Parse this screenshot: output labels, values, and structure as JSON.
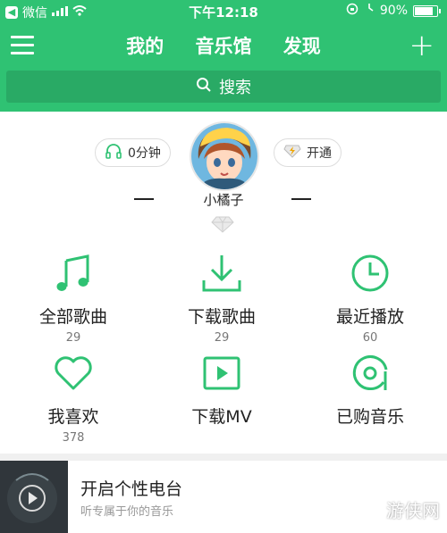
{
  "status_bar": {
    "carrier": "微信",
    "time": "下午12:18",
    "battery": "90%",
    "battery_level": 0.9
  },
  "nav": {
    "tabs": [
      "我的",
      "音乐馆",
      "发现"
    ],
    "menu_icon": "hamburger-menu-icon",
    "add_icon": "plus-icon"
  },
  "search": {
    "label": "搜索"
  },
  "profile": {
    "listen_time": "0分钟",
    "open_vip": "开通",
    "username": "小橘子"
  },
  "grid": [
    {
      "label": "全部歌曲",
      "count": "29",
      "icon": "music-note-icon"
    },
    {
      "label": "下载歌曲",
      "count": "29",
      "icon": "download-icon"
    },
    {
      "label": "最近播放",
      "count": "60",
      "icon": "clock-icon"
    },
    {
      "label": "我喜欢",
      "count": "378",
      "icon": "heart-icon"
    },
    {
      "label": "下载MV",
      "count": "",
      "icon": "video-play-icon"
    },
    {
      "label": "已购音乐",
      "count": "",
      "icon": "purchased-disc-icon"
    }
  ],
  "radio": {
    "title": "开启个性电台",
    "subtitle": "听专属于你的音乐"
  },
  "watermark": "游侠网",
  "colors": {
    "accent": "#2fc273",
    "text": "#222222"
  }
}
